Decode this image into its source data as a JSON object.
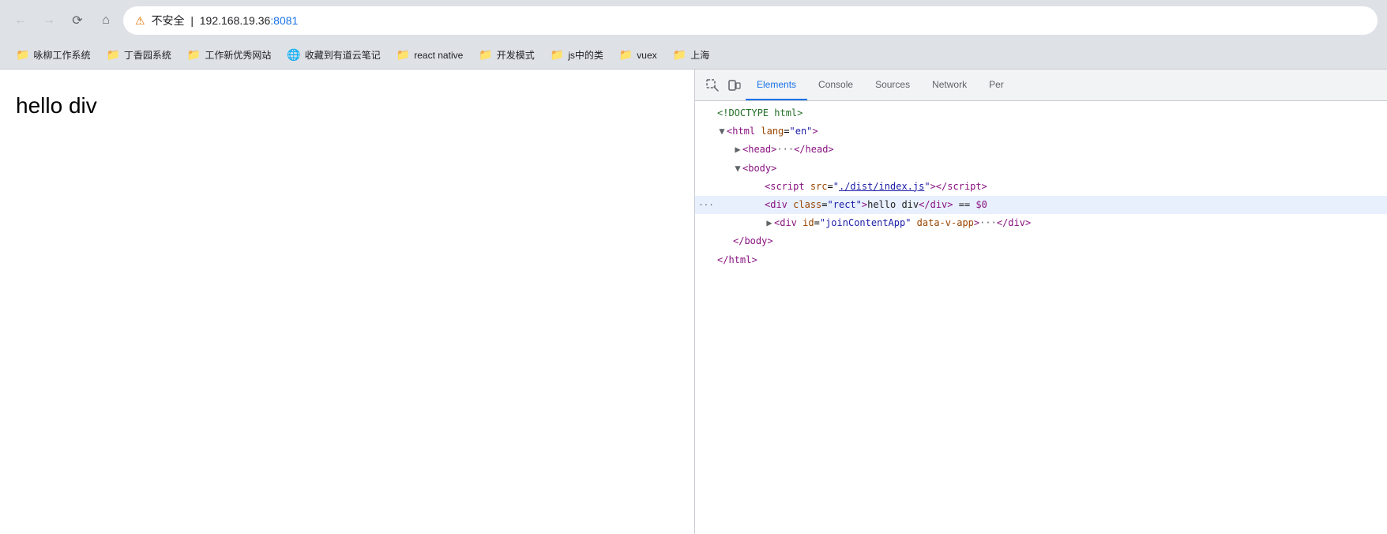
{
  "browser": {
    "back_disabled": true,
    "forward_disabled": true,
    "address": {
      "warning_label": "不安全",
      "url_text": "192.168.19.36",
      "url_port": ":8081"
    }
  },
  "bookmarks": [
    {
      "id": "bm1",
      "label": "咏柳工作系统",
      "type": "folder"
    },
    {
      "id": "bm2",
      "label": "丁香园系统",
      "type": "folder"
    },
    {
      "id": "bm3",
      "label": "工作新优秀网站",
      "type": "folder"
    },
    {
      "id": "bm4",
      "label": "收藏到有道云笔记",
      "type": "globe"
    },
    {
      "id": "bm5",
      "label": "react native",
      "type": "folder"
    },
    {
      "id": "bm6",
      "label": "开发模式",
      "type": "folder"
    },
    {
      "id": "bm7",
      "label": "js中的类",
      "type": "folder"
    },
    {
      "id": "bm8",
      "label": "vuex",
      "type": "folder"
    },
    {
      "id": "bm9",
      "label": "上海",
      "type": "folder"
    }
  ],
  "page": {
    "hello_text": "hello  div"
  },
  "devtools": {
    "tabs": [
      {
        "id": "elements",
        "label": "Elements",
        "active": true
      },
      {
        "id": "console",
        "label": "Console",
        "active": false
      },
      {
        "id": "sources",
        "label": "Sources",
        "active": false
      },
      {
        "id": "network",
        "label": "Network",
        "active": false
      },
      {
        "id": "per",
        "label": "Per",
        "active": false
      }
    ],
    "dom_lines": [
      {
        "id": "line1",
        "indent": 0,
        "has_triangle": false,
        "triangle_open": false,
        "dots": false,
        "highlighted": false,
        "content_type": "doctype",
        "raw": "<!DOCTYPE html>"
      },
      {
        "id": "line2",
        "indent": 0,
        "has_triangle": true,
        "triangle_open": true,
        "dots": false,
        "highlighted": false,
        "content_type": "tag_open",
        "tag": "html",
        "attrs": [
          {
            "name": "lang",
            "value": "\"en\""
          }
        ]
      },
      {
        "id": "line3",
        "indent": 1,
        "has_triangle": true,
        "triangle_open": false,
        "dots": false,
        "highlighted": false,
        "content_type": "collapsed_tag",
        "tag": "head",
        "suffix": "···</head>"
      },
      {
        "id": "line4",
        "indent": 1,
        "has_triangle": true,
        "triangle_open": true,
        "dots": false,
        "highlighted": false,
        "content_type": "tag_open_only",
        "tag": "body"
      },
      {
        "id": "line5",
        "indent": 2,
        "has_triangle": false,
        "triangle_open": false,
        "dots": false,
        "highlighted": false,
        "content_type": "script_tag",
        "tag": "script",
        "attr_name": "src",
        "attr_link": "./dist/index.js"
      },
      {
        "id": "line6",
        "indent": 2,
        "has_triangle": false,
        "triangle_open": false,
        "dots": true,
        "highlighted": true,
        "content_type": "div_hello",
        "tag": "div",
        "attr_name": "class",
        "attr_value": "rect",
        "inner": "hello div",
        "suffix": " == $0"
      },
      {
        "id": "line7",
        "indent": 2,
        "has_triangle": true,
        "triangle_open": false,
        "dots": false,
        "highlighted": false,
        "content_type": "div_join",
        "tag": "div",
        "attr_id": "joinContentApp",
        "attr_data": "data-v-app",
        "suffix": "···</div>"
      },
      {
        "id": "line8",
        "indent": 1,
        "has_triangle": false,
        "triangle_open": false,
        "dots": false,
        "highlighted": false,
        "content_type": "close_tag",
        "tag": "body"
      },
      {
        "id": "line9",
        "indent": 0,
        "has_triangle": false,
        "triangle_open": false,
        "dots": false,
        "highlighted": false,
        "content_type": "close_tag",
        "tag": "html"
      }
    ]
  }
}
